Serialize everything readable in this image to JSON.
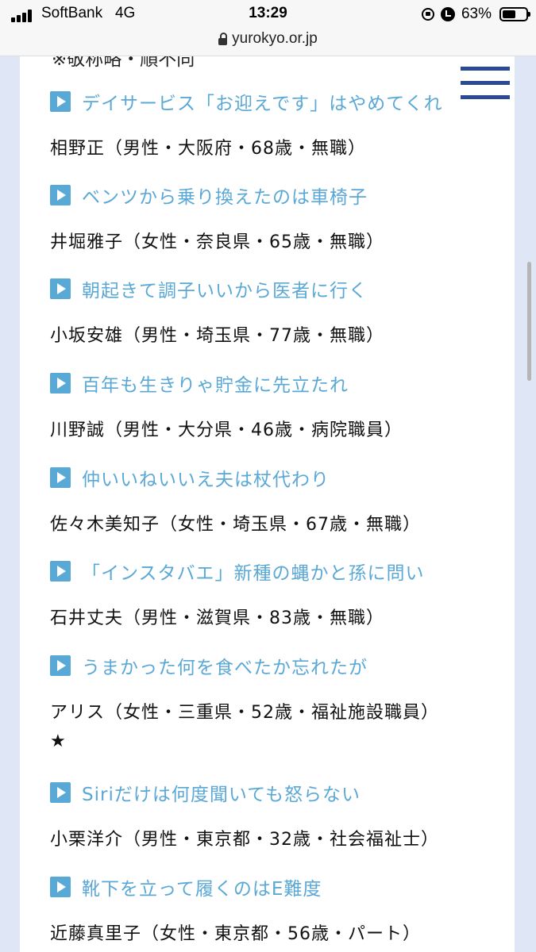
{
  "status_bar": {
    "carrier": "SoftBank",
    "network": "4G",
    "time": "13:29",
    "battery": "63%",
    "battery_level": 0.63
  },
  "browser": {
    "url": "yurokyo.or.jp"
  },
  "page": {
    "top_note": "※敬称略・順不同",
    "entries": [
      {
        "title": "デイサービス「お迎えです」はやめてくれ",
        "author": "相野正（男性・大阪府・68歳・無職）"
      },
      {
        "title": "ベンツから乗り換えたのは車椅子",
        "author": "井堀雅子（女性・奈良県・65歳・無職）"
      },
      {
        "title": "朝起きて調子いいから医者に行く",
        "author": "小坂安雄（男性・埼玉県・77歳・無職）"
      },
      {
        "title": "百年も生きりゃ貯金に先立たれ",
        "author": "川野誠（男性・大分県・46歳・病院職員）"
      },
      {
        "title": "仲いいねいいえ夫は杖代わり",
        "author": "佐々木美知子（女性・埼玉県・67歳・無職）"
      },
      {
        "title": "「インスタバエ」新種の蝿かと孫に問い",
        "author": "石井丈夫（男性・滋賀県・83歳・無職）"
      },
      {
        "title": "うまかった何を食べたか忘れたが",
        "author": "アリス（女性・三重県・52歳・福祉施設職員）",
        "mark": "★"
      },
      {
        "title": "Siriだけは何度聞いても怒らない",
        "author": "小栗洋介（男性・東京都・32歳・社会福祉士）"
      },
      {
        "title": "靴下を立って履くのはE難度",
        "author": "近藤真里子（女性・東京都・56歳・パート）"
      }
    ]
  },
  "colors": {
    "accent": "#5aa8d6",
    "icon": "#58a9d6",
    "menu": "#2c4a93",
    "frame": "#dfe7f6"
  }
}
